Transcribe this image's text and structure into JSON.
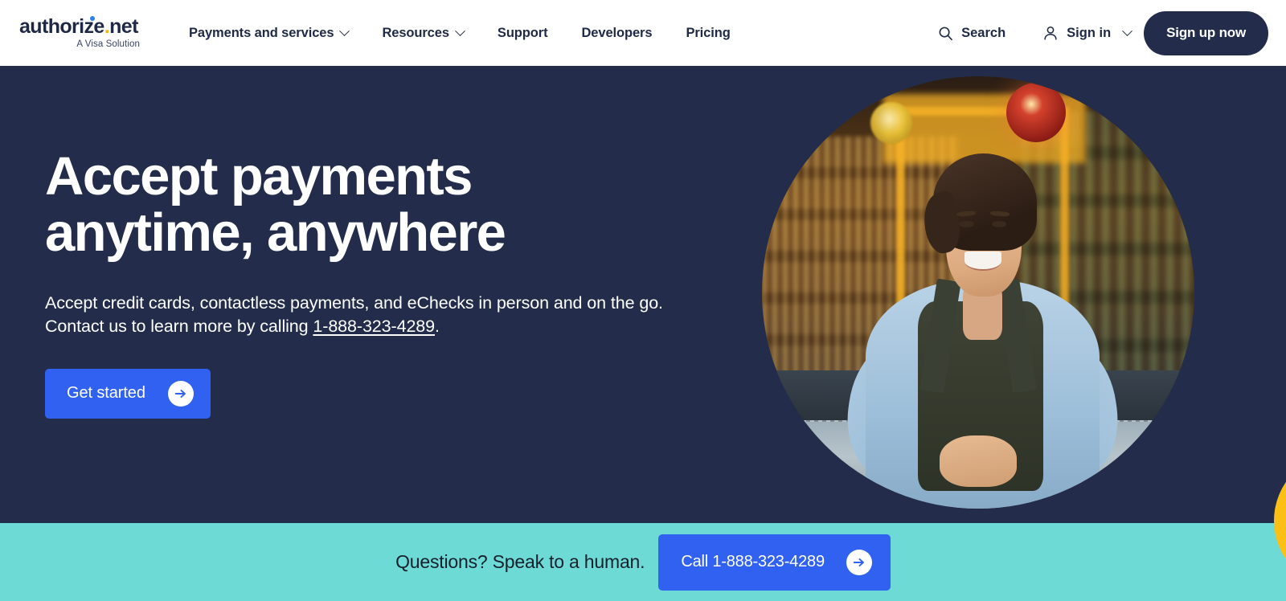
{
  "header": {
    "logo": {
      "word_before_dot": "authorize",
      "dot": ".",
      "word_after_dot": "net",
      "tagline": "A Visa Solution"
    },
    "nav": [
      {
        "label": "Payments and services",
        "has_chevron": true
      },
      {
        "label": "Resources",
        "has_chevron": true
      },
      {
        "label": "Support",
        "has_chevron": false
      },
      {
        "label": "Developers",
        "has_chevron": false
      },
      {
        "label": "Pricing",
        "has_chevron": false
      }
    ],
    "search_label": "Search",
    "signin_label": "Sign in",
    "signup_label": "Sign up now"
  },
  "hero": {
    "title": "Accept payments anytime, anywhere",
    "sub_line1": "Accept credit cards, contactless payments, and eChecks in person and on the go.",
    "sub_line2_prefix": "Contact us to learn more by calling ",
    "sub_phone": "1-888-323-4289",
    "sub_line2_suffix": ".",
    "cta_label": "Get started"
  },
  "cta_bar": {
    "text": "Questions? Speak to a human.",
    "button_label": "Call 1-888-323-4289"
  },
  "colors": {
    "navy": "#232d4b",
    "blue": "#3161f0",
    "teal": "#6edad5",
    "gold": "#fbbf16",
    "logo_dot_blue": "#2b7ff0",
    "logo_dot_gold": "#f4b71a"
  }
}
